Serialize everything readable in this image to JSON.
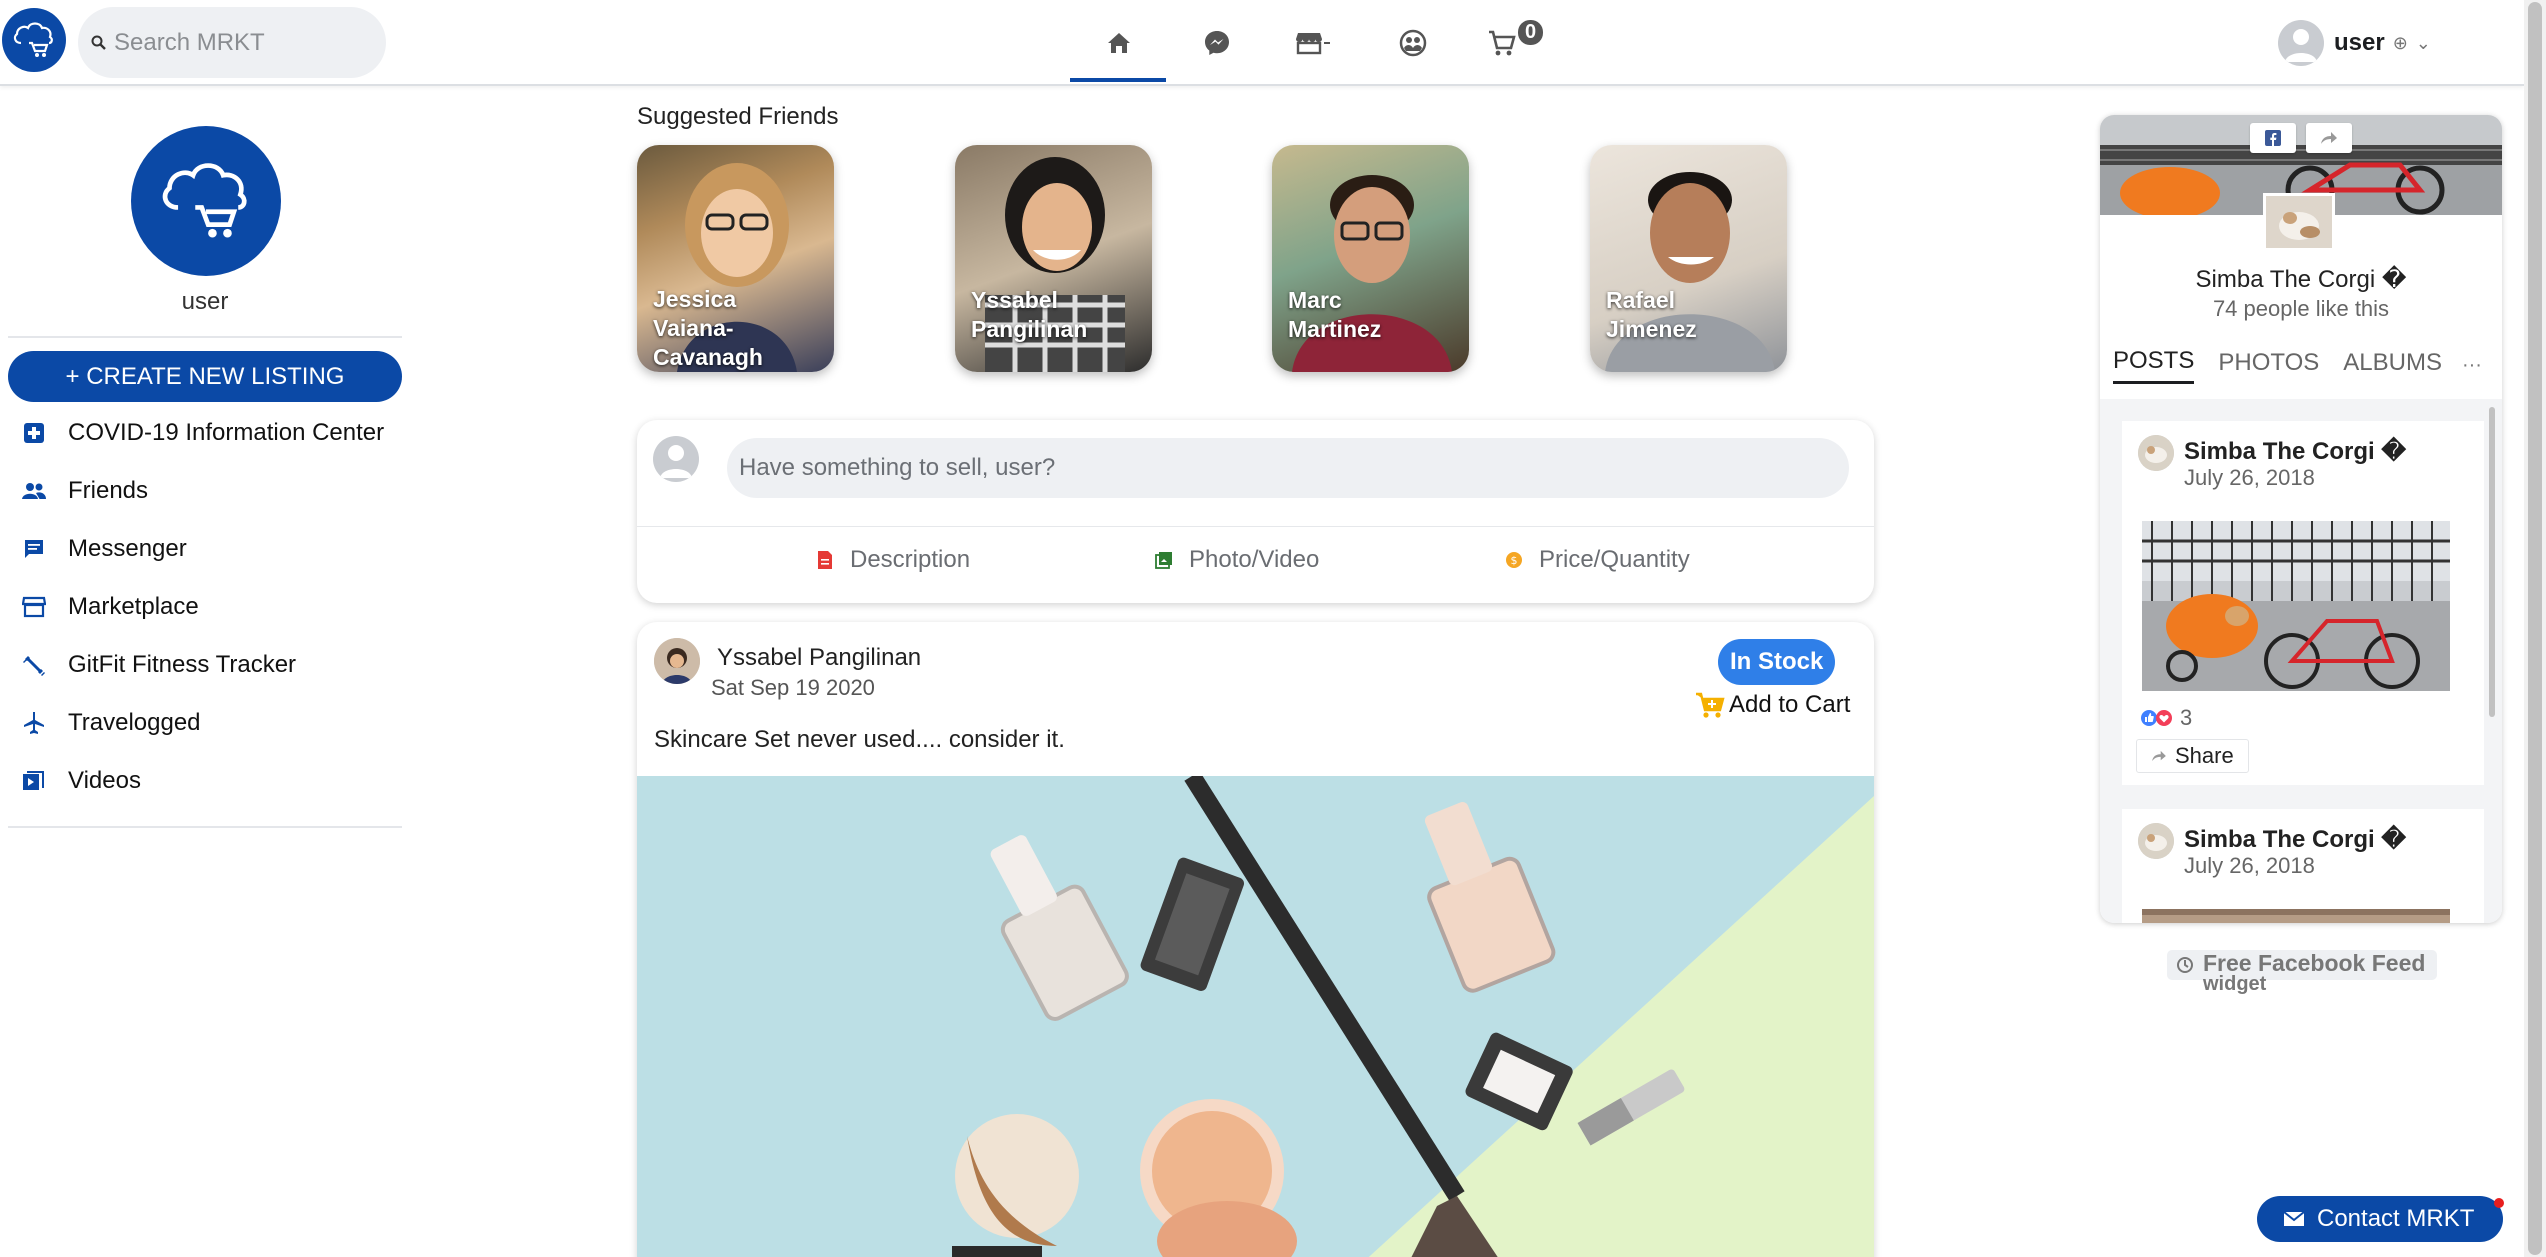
{
  "header": {
    "search_placeholder": "Search MRKT",
    "cart_count": "0",
    "user_name": "user",
    "nav": [
      {
        "name": "home",
        "active": true
      },
      {
        "name": "messenger",
        "active": false
      },
      {
        "name": "marketplace",
        "active": false
      },
      {
        "name": "groups",
        "active": false
      },
      {
        "name": "cart",
        "active": false
      }
    ]
  },
  "sidebar": {
    "profile_name": "user",
    "create_label": "+ CREATE NEW LISTING",
    "items": [
      {
        "label": "COVID-19 Information Center",
        "icon": "medical-plus-icon"
      },
      {
        "label": "Friends",
        "icon": "friends-icon"
      },
      {
        "label": "Messenger",
        "icon": "chat-icon"
      },
      {
        "label": "Marketplace",
        "icon": "store-icon"
      },
      {
        "label": "GitFit Fitness Tracker",
        "icon": "fitness-icon"
      },
      {
        "label": "Travelogged",
        "icon": "airplane-icon"
      },
      {
        "label": "Videos",
        "icon": "video-icon"
      }
    ]
  },
  "suggested": {
    "title": "Suggested Friends",
    "friends": [
      {
        "name_line1": "Jessica",
        "name_line2": "Vaiana-",
        "name_line3": "Cavanagh"
      },
      {
        "name_line1": "Yssabel",
        "name_line2": "Pangilinan",
        "name_line3": ""
      },
      {
        "name_line1": "Marc",
        "name_line2": "Martinez",
        "name_line3": ""
      },
      {
        "name_line1": "Rafael",
        "name_line2": "Jimenez",
        "name_line3": ""
      }
    ]
  },
  "composer": {
    "placeholder": "Have something to sell, user?",
    "description_label": "Description",
    "photo_label": "Photo/Video",
    "price_label": "Price/Quantity"
  },
  "post": {
    "author": "Yssabel Pangilinan",
    "date": "Sat Sep 19 2020",
    "stock_label": "In Stock",
    "add_cart_label": "Add to Cart",
    "text": "Skincare Set never used.... consider it."
  },
  "fb_widget": {
    "page_name": "Simba The Corgi �",
    "likes": "74 people like this",
    "tabs": [
      "POSTS",
      "PHOTOS",
      "ALBUMS"
    ],
    "more": "···",
    "posts": [
      {
        "name": "Simba The Corgi �",
        "date": "July 26, 2018",
        "reactions": "3",
        "share": "Share"
      },
      {
        "name": "Simba The Corgi �",
        "date": "July 26, 2018"
      }
    ],
    "free_feed_line1": "Free Facebook Feed",
    "free_feed_line2": "widget"
  },
  "contact": {
    "label": "Contact MRKT"
  },
  "colors": {
    "brand": "#0b49a6",
    "stock": "#2f7fe8",
    "notify": "#e81e1e"
  }
}
